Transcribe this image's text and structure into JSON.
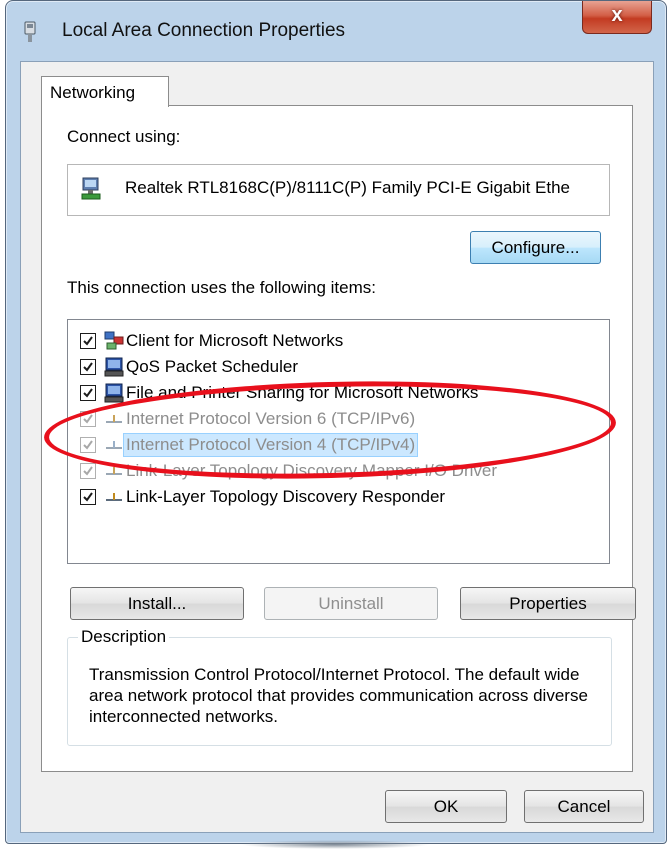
{
  "window": {
    "title": "Local Area Connection Properties",
    "close_label": "x"
  },
  "tabs": [
    {
      "label": "Networking",
      "active": true
    }
  ],
  "connect_using": {
    "label": "Connect using:",
    "adapter_name": "Realtek RTL8168C(P)/8111C(P) Family PCI-E Gigabit Ethe",
    "adapter_icon": "network-adapter-icon"
  },
  "configure_button": "Configure...",
  "items_label": "This connection uses the following items:",
  "items": [
    {
      "label": "Client for Microsoft Networks",
      "checked": true,
      "enabled": true,
      "selected": false,
      "icon": "network-client-icon"
    },
    {
      "label": "QoS Packet Scheduler",
      "checked": true,
      "enabled": true,
      "selected": false,
      "icon": "network-service-icon"
    },
    {
      "label": "File and Printer Sharing for Microsoft Networks",
      "checked": true,
      "enabled": true,
      "selected": false,
      "icon": "network-service-icon"
    },
    {
      "label": "Internet Protocol Version 6 (TCP/IPv6)",
      "checked": true,
      "enabled": false,
      "selected": false,
      "icon": "protocol-icon"
    },
    {
      "label": "Internet Protocol Version 4 (TCP/IPv4)",
      "checked": true,
      "enabled": false,
      "selected": true,
      "icon": "protocol-icon"
    },
    {
      "label": "Link-Layer Topology Discovery Mapper I/O Driver",
      "checked": true,
      "enabled": false,
      "selected": false,
      "icon": "protocol-icon"
    },
    {
      "label": "Link-Layer Topology Discovery Responder",
      "checked": true,
      "enabled": true,
      "selected": false,
      "icon": "protocol-icon"
    }
  ],
  "buttons": {
    "install": "Install...",
    "uninstall": "Uninstall",
    "properties": "Properties",
    "ok": "OK",
    "cancel": "Cancel"
  },
  "description": {
    "legend": "Description",
    "text": "Transmission Control Protocol/Internet Protocol. The default wide area network protocol that provides communication across diverse interconnected networks."
  },
  "colors": {
    "highlight_oval": "#e8101c",
    "selection_bg": "#cce8ff",
    "close_button": "#c8432a"
  }
}
